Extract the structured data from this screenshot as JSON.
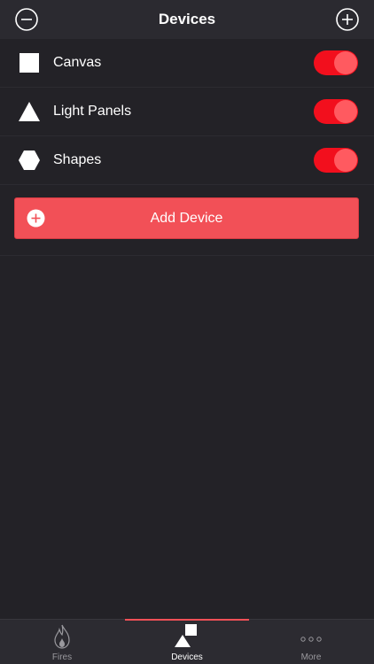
{
  "header": {
    "title": "Devices",
    "left_icon": "minus-circle-icon",
    "right_icon": "plus-circle-icon"
  },
  "devices": [
    {
      "label": "Canvas",
      "shape": "square",
      "enabled": true
    },
    {
      "label": "Light Panels",
      "shape": "triangle",
      "enabled": true
    },
    {
      "label": "Shapes",
      "shape": "hexagon",
      "enabled": true
    }
  ],
  "add_device": {
    "label": "Add Device",
    "icon": "plus-circle-icon"
  },
  "tabs": [
    {
      "label": "Fires",
      "icon": "flame-icon",
      "active": false
    },
    {
      "label": "Devices",
      "icon": "devices-icon",
      "active": true
    },
    {
      "label": "More",
      "icon": "more-dots-icon",
      "active": false
    }
  ],
  "colors": {
    "background": "#232227",
    "header": "#2b2a30",
    "accent": "#f25057",
    "toggle_on": "#f20f1d",
    "toggle_knob": "#ff5a60"
  }
}
